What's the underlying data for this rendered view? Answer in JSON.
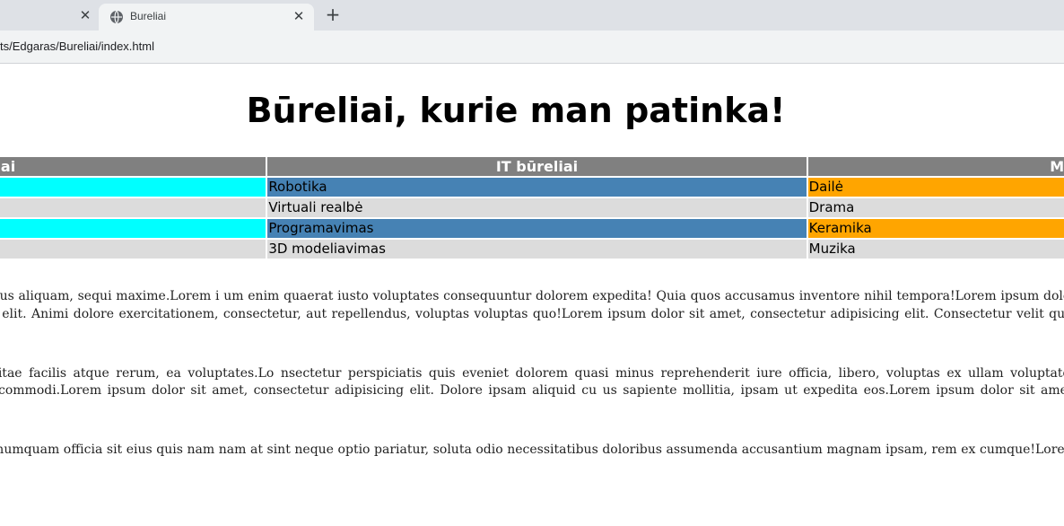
{
  "browser": {
    "tabs": [
      {
        "title": "",
        "active": false
      },
      {
        "title": "Bureliai",
        "active": true
      }
    ],
    "url": "ts/Edgaras/Bureliai/index.html"
  },
  "page": {
    "heading": "Būreliai, kurie man patinka!",
    "table": {
      "headers": [
        "eliai",
        "IT būreliai",
        "Men"
      ],
      "rows": [
        [
          "",
          "Robotika",
          "Dailė"
        ],
        [
          "",
          "Virtuali realbė",
          "Drama"
        ],
        [
          "",
          "Programavimas",
          "Keramika"
        ],
        [
          "",
          "3D modeliavimas",
          "Muzika"
        ]
      ]
    },
    "paragraphs": [
      "it. Sed repudiandae iste praesentium nam quasi vero ullam omnis labore obcaecati, odio nihil illo, culpa deleniti aliquam. Amet necessitatibus aliquam, sequi maxime.Lorem i um enim quaerat iusto voluptates consequuntur dolorem expedita! Quia quos accusamus inventore nihil tempora!Lorem ipsum dolor sit amet, consectetur adipisicing elit. Qu e corporis iure blanditiis ea nihil culpa eum.Lorem ipsum dolor sit amet, consectetur adipisicing elit. Animi dolore exercitationem, consectetur, aut repellendus, voluptas voluptas quo!Lorem ipsum dolor sit amet, consectetur adipisicing elit. Consectetur velit quia obcaecati eveniet ipsa dolore ut excepturi modi numquam ipsam, amet corporis",
      "it. Vel, autem eligendi! Nulla iure, voluptatibus enim quam impedit nisi, aspernatur assumenda, cum dolorem architecto explicabo. Vitae facilis atque rerum, ea voluptates.Lo nsectetur perspiciatis quis eveniet dolorem quasi minus reprehenderit iure officia, libero, voluptas ex ullam voluptates voluptate.Lorem ipsum dolor sit amet, consectetur a i neque. Rerum aspernatur quidem facere, dolores sit expedita ut ipsa voluptates commodi.Lorem ipsum dolor sit amet, consectetur adipisicing elit. Dolore ipsam aliquid cu us sapiente mollitia, ipsam ut expedita eos.Lorem ipsum dolor sit amet, consectetur adipisicing elit. Natus possimus ut aliquam error, nemo architecto voluptate totam aliqu",
      "it. Perferendis quasi iste in obcaecati voluptatum assumenda, sapiente? Reprehenderit cumque maiores illo tempore quibusdam, explicabo numquam officia sit eius quis nam nam at sint neque optio pariatur, soluta odio necessitatibus doloribus assumenda accusantium magnam ipsam, rem ex cumque!Lorem ipsum dolor sit amet, consectetur adip"
    ]
  },
  "colors": {
    "header_bg": "#808080",
    "row_odd_col1": "#00ffff",
    "row_odd_col2": "#4682b4",
    "row_odd_col3": "#ffa500",
    "row_even": "#dcdcdc"
  },
  "icons": {
    "tab_favicon": "globe-icon",
    "tab_close": "close-icon",
    "new_tab": "plus-icon"
  }
}
